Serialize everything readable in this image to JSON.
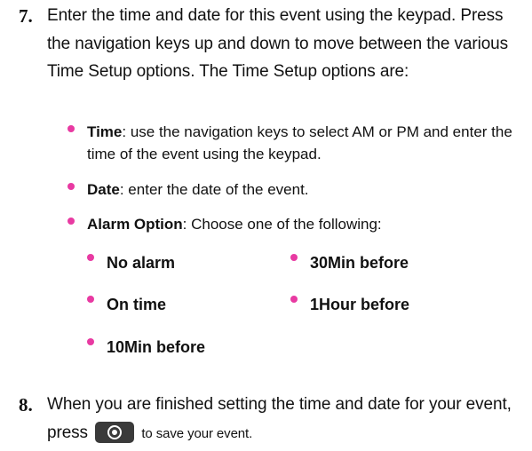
{
  "step7": {
    "number": "7.",
    "text": "Enter the time and date for this event using the keypad. Press the navigation keys up and down to move between the various Time Setup options. The Time Setup options are:"
  },
  "options": [
    {
      "term": "Time",
      "desc": ": use the navigation keys to select AM or PM and enter the time of the event using the keypad."
    },
    {
      "term": "Date",
      "desc": ": enter the date of the event."
    },
    {
      "term": "Alarm Option",
      "desc": ": Choose one of the following:"
    }
  ],
  "alarm_options": [
    "No alarm",
    "30Min before",
    "On time",
    "1Hour before",
    "10Min before"
  ],
  "step8": {
    "number": "8.",
    "text_before": "When you are finished setting the time and date for your event, press",
    "text_after": "to save your event.",
    "key_icon": "ok-key-icon"
  },
  "colors": {
    "bullet": "#e83aa2",
    "text": "#111111"
  }
}
